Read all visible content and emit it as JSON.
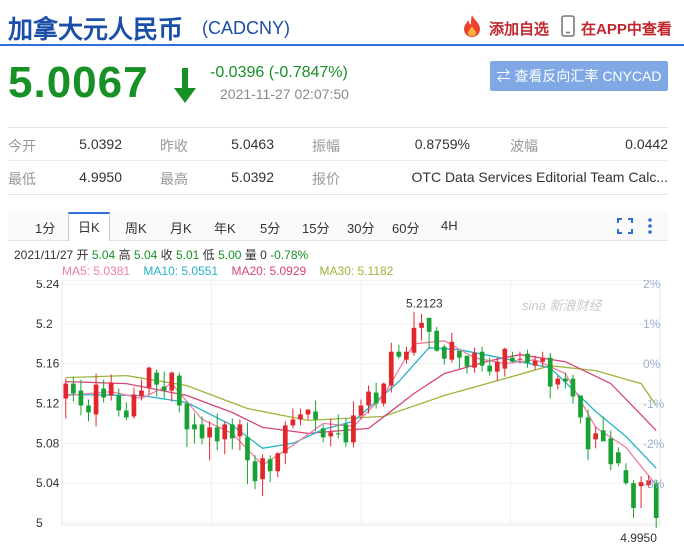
{
  "header": {
    "title": "加拿大元人民币",
    "code": "(CADCNY)",
    "add_watch": "添加自选",
    "view_app": "在APP中查看"
  },
  "quote": {
    "price": "5.0067",
    "change": "-0.0396 (-0.7847%)",
    "time": "2021-11-27 02:07:50",
    "reverse_button": "查看反向汇率 CNYCAD"
  },
  "stats": [
    [
      {
        "label": "今开",
        "value": "5.0392"
      },
      {
        "label": "昨收",
        "value": "5.0463"
      },
      {
        "label": "振幅",
        "value": "0.8759%"
      },
      {
        "label": "波幅",
        "value": "0.0442"
      }
    ],
    [
      {
        "label": "最低",
        "value": "4.9950"
      },
      {
        "label": "最高",
        "value": "5.0392"
      },
      {
        "label": "报价",
        "value": "OTC Data Services Editorial Team Calc..."
      }
    ]
  ],
  "tabs": [
    "1分",
    "日K",
    "周K",
    "月K",
    "年K",
    "5分",
    "15分",
    "30分",
    "60分",
    "4H"
  ],
  "active_tab": 1,
  "info": {
    "date": "2021/11/27",
    "open_label": "开",
    "open": "5.04",
    "high_label": "高",
    "high": "5.04",
    "close_label": "收",
    "close": "5.01",
    "low_label": "低",
    "low": "5.00",
    "vol_label": "量",
    "vol": "0",
    "pct": "-0.78%"
  },
  "ma_legend": [
    {
      "text": "MA5: 5.0381",
      "color": "#f07fa6"
    },
    {
      "text": "MA10: 5.0551",
      "color": "#25b5c8"
    },
    {
      "text": "MA20: 5.0929",
      "color": "#d8437a"
    },
    {
      "text": "MA30: 5.1182",
      "color": "#9db53a"
    }
  ],
  "colors": {
    "up": "#e3262c",
    "down": "#19a234",
    "accent": "#2f6fd6"
  },
  "watermark": "sina 新浪财经",
  "chart_data": {
    "type": "candlestick",
    "title": "",
    "ylim": [
      5.0,
      5.24
    ],
    "yticks": [
      5.24,
      5.2,
      5.16,
      5.12,
      5.08,
      5.04,
      5
    ],
    "right_ticks": [
      "2%",
      "1%",
      "0%",
      "-1%",
      "-2%",
      "-3%"
    ],
    "right_tick_values": [
      2,
      1,
      0,
      -1,
      -2,
      -3
    ],
    "annotations": [
      {
        "text": "5.2123",
        "value": 5.2123
      },
      {
        "text": "4.9950",
        "value": 4.995
      }
    ],
    "candles": [
      [
        5.125,
        5.14,
        5.11,
        5.145,
        5.105
      ],
      [
        5.14,
        5.13,
        5.123,
        5.147,
        5.122
      ],
      [
        5.133,
        5.118,
        5.111,
        5.144,
        5.108
      ],
      [
        5.118,
        5.111,
        5.105,
        5.124,
        5.102
      ],
      [
        5.109,
        5.139,
        5.137,
        5.15,
        5.097
      ],
      [
        5.135,
        5.126,
        5.129,
        5.144,
        5.121
      ],
      [
        5.128,
        5.141,
        5.135,
        5.149,
        5.123
      ],
      [
        5.128,
        5.113,
        5.111,
        5.135,
        5.107
      ],
      [
        5.113,
        5.106,
        5.106,
        5.121,
        5.103
      ],
      [
        5.107,
        5.129,
        5.121,
        5.136,
        5.105
      ],
      [
        5.127,
        5.133,
        5.132,
        5.144,
        5.123
      ],
      [
        5.136,
        5.156,
        5.145,
        5.157,
        5.129
      ],
      [
        5.151,
        5.139,
        5.141,
        5.154,
        5.127
      ],
      [
        5.137,
        5.133,
        5.134,
        5.152,
        5.125
      ],
      [
        5.133,
        5.151,
        5.143,
        5.152,
        5.122
      ],
      [
        5.148,
        5.118,
        5.121,
        5.151,
        5.111
      ],
      [
        5.12,
        5.094,
        5.092,
        5.122,
        5.076
      ],
      [
        5.099,
        5.094,
        5.082,
        5.11,
        5.08
      ],
      [
        5.099,
        5.085,
        5.095,
        5.107,
        5.079
      ],
      [
        5.086,
        5.096,
        5.096,
        5.102,
        5.063
      ],
      [
        5.096,
        5.082,
        5.086,
        5.11,
        5.073
      ],
      [
        5.084,
        5.099,
        5.089,
        5.102,
        5.069
      ],
      [
        5.099,
        5.085,
        5.08,
        5.105,
        5.074
      ],
      [
        5.087,
        5.099,
        5.087,
        5.104,
        5.073
      ],
      [
        5.086,
        5.063,
        5.063,
        5.101,
        5.039
      ],
      [
        5.062,
        5.042,
        5.052,
        5.068,
        5.034
      ],
      [
        5.044,
        5.065,
        5.062,
        5.069,
        5.027
      ],
      [
        5.064,
        5.052,
        5.054,
        5.068,
        5.041
      ],
      [
        5.052,
        5.07,
        5.06,
        5.071,
        5.046
      ],
      [
        5.07,
        5.098,
        5.098,
        5.102,
        5.059
      ],
      [
        5.098,
        5.104,
        5.111,
        5.115,
        5.095
      ],
      [
        5.104,
        5.109,
        5.108,
        5.115,
        5.098
      ],
      [
        5.109,
        5.114,
        5.107,
        5.112,
        5.104
      ],
      [
        5.112,
        5.104,
        5.09,
        5.123,
        5.092
      ],
      [
        5.095,
        5.086,
        5.088,
        5.099,
        5.081
      ],
      [
        5.087,
        5.091,
        5.094,
        5.105,
        5.077
      ],
      [
        5.09,
        5.089,
        5.1,
        5.109,
        5.085
      ],
      [
        5.099,
        5.081,
        5.081,
        5.105,
        5.076
      ],
      [
        5.081,
        5.108,
        5.11,
        5.122,
        5.076
      ],
      [
        5.108,
        5.118,
        5.12,
        5.124,
        5.104
      ],
      [
        5.118,
        5.132,
        5.129,
        5.138,
        5.11
      ],
      [
        5.131,
        5.12,
        5.125,
        5.141,
        5.115
      ],
      [
        5.12,
        5.14,
        5.137,
        5.141,
        5.117
      ],
      [
        5.138,
        5.172,
        5.174,
        5.181,
        5.131
      ],
      [
        5.172,
        5.167,
        5.167,
        5.179,
        5.165
      ],
      [
        5.164,
        5.172,
        5.169,
        5.177,
        5.16
      ],
      [
        5.171,
        5.196,
        5.188,
        5.212,
        5.168
      ],
      [
        5.196,
        5.201,
        5.206,
        5.21,
        5.183
      ],
      [
        5.206,
        5.192,
        5.192,
        5.206,
        5.175
      ],
      [
        5.193,
        5.173,
        5.177,
        5.197,
        5.172
      ],
      [
        5.177,
        5.165,
        5.165,
        5.179,
        5.159
      ],
      [
        5.164,
        5.182,
        5.174,
        5.191,
        5.161
      ],
      [
        5.173,
        5.166,
        5.162,
        5.171,
        5.155
      ],
      [
        5.168,
        5.157,
        5.158,
        5.167,
        5.15
      ],
      [
        5.156,
        5.171,
        5.171,
        5.176,
        5.151
      ],
      [
        5.172,
        5.158,
        5.157,
        5.177,
        5.152
      ],
      [
        5.158,
        5.152,
        5.152,
        5.166,
        5.148
      ],
      [
        5.152,
        5.162,
        5.154,
        5.166,
        5.143
      ],
      [
        5.155,
        5.175,
        5.166,
        5.176,
        5.147
      ],
      [
        5.166,
        5.162,
        5.166,
        5.172,
        5.161
      ],
      [
        5.165,
        5.165,
        5.17,
        5.172,
        5.16
      ],
      [
        5.17,
        5.161,
        5.161,
        5.174,
        5.156
      ],
      [
        5.158,
        5.163,
        5.162,
        5.168,
        5.154
      ],
      [
        5.162,
        5.165,
        5.166,
        5.172,
        5.157
      ],
      [
        5.166,
        5.137,
        5.14,
        5.171,
        5.125
      ],
      [
        5.139,
        5.145,
        5.144,
        5.148,
        5.134
      ],
      [
        5.145,
        5.142,
        5.143,
        5.151,
        5.135
      ],
      [
        5.145,
        5.127,
        5.128,
        5.149,
        5.12
      ],
      [
        5.128,
        5.106,
        5.108,
        5.127,
        5.1
      ],
      [
        5.106,
        5.074,
        5.081,
        5.114,
        5.063
      ],
      [
        5.084,
        5.09,
        5.093,
        5.097,
        5.075
      ],
      [
        5.093,
        5.082,
        5.085,
        5.107,
        5.084
      ],
      [
        5.085,
        5.059,
        5.071,
        5.093,
        5.053
      ],
      [
        5.071,
        5.06,
        5.057,
        5.076,
        5.057
      ],
      [
        5.053,
        5.04,
        5.057,
        5.06,
        5.038
      ],
      [
        5.04,
        5.015,
        5.037,
        5.043,
        5.005
      ],
      [
        5.037,
        5.041,
        5.039,
        5.047,
        5.015
      ],
      [
        5.038,
        5.043,
        5.045,
        5.048,
        5.035
      ],
      [
        5.04,
        5.005,
        5.011,
        5.043,
        4.995
      ]
    ],
    "ma5": [
      [
        0,
        5.128
      ],
      [
        6,
        5.132
      ],
      [
        10,
        5.125
      ],
      [
        14,
        5.14
      ],
      [
        18,
        5.104
      ],
      [
        22,
        5.09
      ],
      [
        26,
        5.058
      ],
      [
        30,
        5.078
      ],
      [
        34,
        5.1
      ],
      [
        38,
        5.097
      ],
      [
        42,
        5.128
      ],
      [
        46,
        5.18
      ],
      [
        50,
        5.183
      ],
      [
        54,
        5.166
      ],
      [
        58,
        5.16
      ],
      [
        62,
        5.164
      ],
      [
        66,
        5.15
      ],
      [
        70,
        5.096
      ],
      [
        74,
        5.076
      ],
      [
        78,
        5.038
      ]
    ],
    "ma10": [
      [
        0,
        5.129
      ],
      [
        10,
        5.128
      ],
      [
        16,
        5.121
      ],
      [
        22,
        5.098
      ],
      [
        26,
        5.075
      ],
      [
        30,
        5.08
      ],
      [
        34,
        5.094
      ],
      [
        38,
        5.102
      ],
      [
        44,
        5.142
      ],
      [
        48,
        5.176
      ],
      [
        52,
        5.174
      ],
      [
        58,
        5.165
      ],
      [
        64,
        5.156
      ],
      [
        70,
        5.112
      ],
      [
        74,
        5.087
      ],
      [
        78,
        5.055
      ]
    ],
    "ma20": [
      [
        0,
        5.142
      ],
      [
        8,
        5.14
      ],
      [
        16,
        5.128
      ],
      [
        22,
        5.111
      ],
      [
        26,
        5.096
      ],
      [
        32,
        5.09
      ],
      [
        40,
        5.095
      ],
      [
        46,
        5.13
      ],
      [
        50,
        5.15
      ],
      [
        56,
        5.163
      ],
      [
        60,
        5.169
      ],
      [
        66,
        5.162
      ],
      [
        72,
        5.14
      ],
      [
        78,
        5.093
      ]
    ],
    "ma30": [
      [
        0,
        5.146
      ],
      [
        8,
        5.148
      ],
      [
        16,
        5.138
      ],
      [
        24,
        5.115
      ],
      [
        32,
        5.103
      ],
      [
        42,
        5.107
      ],
      [
        50,
        5.128
      ],
      [
        58,
        5.145
      ],
      [
        64,
        5.158
      ],
      [
        70,
        5.153
      ],
      [
        76,
        5.14
      ],
      [
        78,
        5.118
      ]
    ]
  }
}
